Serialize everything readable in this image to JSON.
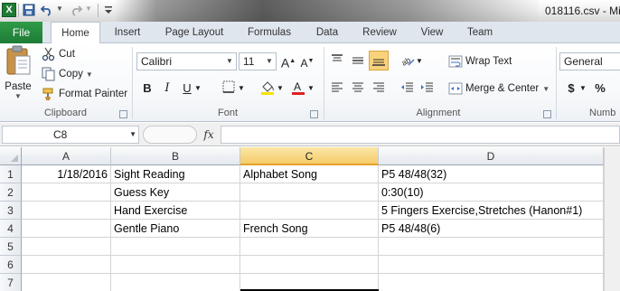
{
  "window": {
    "title": "018116.csv - Mi",
    "app_icon": "excel-icon"
  },
  "qat": {
    "save_icon": "save-icon",
    "undo_icon": "undo-icon",
    "redo_icon": "redo-icon"
  },
  "tabs": [
    "File",
    "Home",
    "Insert",
    "Page Layout",
    "Formulas",
    "Data",
    "Review",
    "View",
    "Team"
  ],
  "active_tab": "Home",
  "ribbon": {
    "clipboard": {
      "paste": "Paste",
      "cut": "Cut",
      "copy": "Copy",
      "format_painter": "Format Painter",
      "group_label": "Clipboard"
    },
    "font": {
      "name": "Calibri",
      "size": "11",
      "group_label": "Font",
      "bold": "B",
      "italic": "I",
      "underline": "U"
    },
    "alignment": {
      "wrap_text": "Wrap Text",
      "merge_center": "Merge & Center",
      "group_label": "Alignment"
    },
    "number": {
      "format": "General",
      "currency": "$",
      "percent": "%",
      "group_label": "Numb"
    }
  },
  "formula_bar": {
    "name_box": "C8",
    "fx_label": "fx",
    "content": ""
  },
  "grid": {
    "columns": [
      "A",
      "B",
      "C",
      "D"
    ],
    "selected_column": "C",
    "rows": [
      {
        "num": "1",
        "A": "1/18/2016",
        "B": "Sight Reading",
        "C": "Alphabet Song",
        "D": "P5 48/48(32)"
      },
      {
        "num": "2",
        "A": "",
        "B": "Guess Key",
        "C": "",
        "D": "0:30(10)"
      },
      {
        "num": "3",
        "A": "",
        "B": "Hand Exercise",
        "C": "",
        "D": "5 Fingers Exercise,Stretches (Hanon#1)"
      },
      {
        "num": "4",
        "A": "",
        "B": "Gentle Piano",
        "C": "French Song",
        "D": "P5 48/48(6)"
      },
      {
        "num": "5",
        "A": "",
        "B": "",
        "C": "",
        "D": ""
      },
      {
        "num": "6",
        "A": "",
        "B": "",
        "C": "",
        "D": ""
      },
      {
        "num": "7",
        "A": "",
        "B": "",
        "C": "",
        "D": ""
      }
    ]
  },
  "colors": {
    "file_tab": "#1d7b35",
    "selected_header": "#f5cc6a",
    "highlight_button": "#f9d27a"
  }
}
